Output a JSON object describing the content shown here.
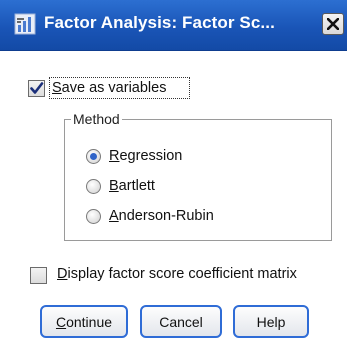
{
  "window": {
    "title": "Factor Analysis: Factor Sc...",
    "title_icon": "factor-analysis-icon",
    "close_icon": "close-icon"
  },
  "save_as_variables": {
    "checked": true,
    "label_pre": "",
    "label_mnemonic": "S",
    "label_post": "ave as variables"
  },
  "method": {
    "group_title": "Method",
    "options": [
      {
        "mnemonic": "R",
        "rest": "egression",
        "selected": true
      },
      {
        "mnemonic": "B",
        "rest": "artlett",
        "selected": false
      },
      {
        "mnemonic": "A",
        "rest": "nderson-Rubin",
        "selected": false
      }
    ]
  },
  "display_matrix": {
    "checked": false,
    "label_mnemonic": "D",
    "label_post": "isplay factor score coefficient matrix"
  },
  "buttons": {
    "continue": {
      "mnemonic": "C",
      "rest": "ontinue"
    },
    "cancel": "Cancel",
    "help": "Help"
  },
  "colors": {
    "titlebar": "#1a55b7",
    "button_border": "#2f6cd6",
    "radio_selected": "#2f63c8"
  }
}
